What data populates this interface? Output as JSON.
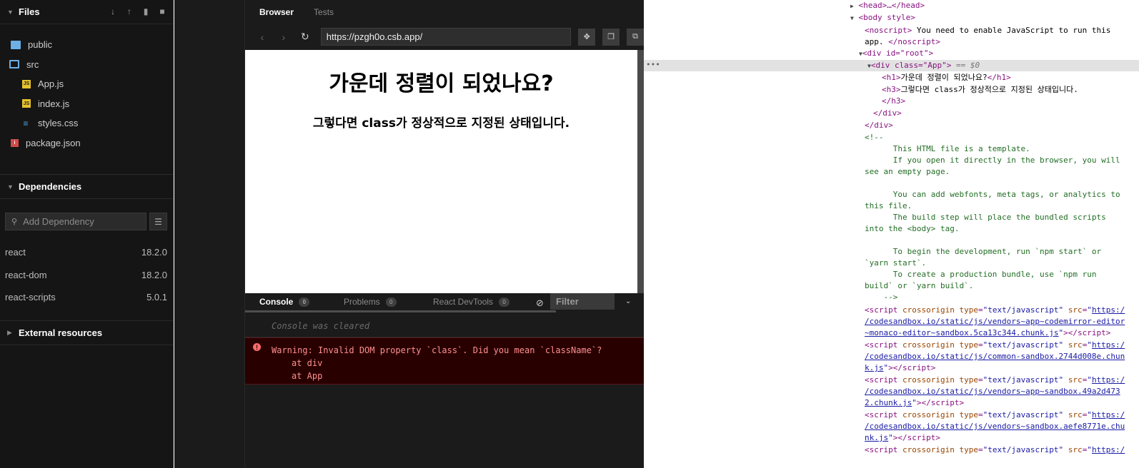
{
  "sidebar": {
    "files_title": "Files",
    "files": [
      {
        "name": "public",
        "icon": "folder-icon",
        "indent": 0
      },
      {
        "name": "src",
        "icon": "folder-open-icon",
        "indent": 0
      },
      {
        "name": "App.js",
        "icon": "js-file-icon",
        "indent": 1
      },
      {
        "name": "index.js",
        "icon": "js-file-icon",
        "indent": 1
      },
      {
        "name": "styles.css",
        "icon": "css-file-icon",
        "indent": 1
      },
      {
        "name": "package.json",
        "icon": "package-icon",
        "indent": 0
      }
    ],
    "dependencies_title": "Dependencies",
    "add_dependency_placeholder": "Add Dependency",
    "dependencies": [
      {
        "name": "react",
        "version": "18.2.0"
      },
      {
        "name": "react-dom",
        "version": "18.2.0"
      },
      {
        "name": "react-scripts",
        "version": "5.0.1"
      }
    ],
    "external_title": "External resources"
  },
  "browser": {
    "tabs": [
      "Browser",
      "Tests"
    ],
    "url": "https://pzgh0o.csb.app/",
    "preview": {
      "h1": "가운데 정렬이 되었나요?",
      "h3": "그렇다면 class가 정상적으로 지정된 상태입니다."
    },
    "console_tabs": [
      {
        "label": "Console",
        "count": "0"
      },
      {
        "label": "Problems",
        "count": "0"
      },
      {
        "label": "React DevTools",
        "count": "0"
      }
    ],
    "filter_placeholder": "Filter",
    "console_cleared": "Console was cleared",
    "warning_lines": [
      "Warning: Invalid DOM property `class`. Did you mean `className`?",
      "at div",
      "at App"
    ]
  },
  "devtools": {
    "head": "<head>…</head>",
    "body_open": "<body style>",
    "noscript_open": "<noscript>",
    "noscript_text_1": " You need to enable JavaScript to run this",
    "noscript_text_2": "app. ",
    "noscript_close": "</noscript>",
    "root_div": "<div id=\"root\">",
    "app_div_tag": "<div class=\"App\">",
    "app_div_eq": " == $0",
    "h1_line": "가운데 정렬이 되었나요?",
    "h3_line": "그렇다면 class가 정상적으로 지정된 상태입니다.",
    "h3_close": "</h3>",
    "div_close_inner": "</div>",
    "div_close_outer": "</div>",
    "comment_lines": [
      "<!--",
      "      This HTML file is a template.",
      "      If you open it directly in the browser, you will",
      "see an empty page.",
      "",
      "      You can add webfonts, meta tags, or analytics to",
      "this file.",
      "      The build step will place the bundled scripts",
      "into the <body> tag.",
      "",
      "      To begin the development, run `npm start` or",
      "`yarn start`.",
      "      To create a production bundle, use `npm run",
      "build` or `yarn build`.",
      "    -->"
    ],
    "scripts": [
      {
        "line1_link": "https:/",
        "line2": "/codesandbox.io/static/js/vendors~app~codemirror-editor",
        "line3": "~monaco-editor~sandbox.5ca13c344.chunk.js"
      },
      {
        "line1_link": "https:/",
        "line2": "/codesandbox.io/static/js/common-sandbox.2744d008e.chun",
        "line3": "k.js"
      },
      {
        "line1_link": "https:/",
        "line2": "/codesandbox.io/static/js/vendors~app~sandbox.49a2d473",
        "line3": "2.chunk.js"
      },
      {
        "line1_link": "https:/",
        "line2": "/codesandbox.io/static/js/vendors~sandbox.aefe8771e.chu",
        "line3": "nk.js"
      },
      {
        "line1_link": "https:/",
        "line2": "",
        "line3": ""
      }
    ]
  }
}
